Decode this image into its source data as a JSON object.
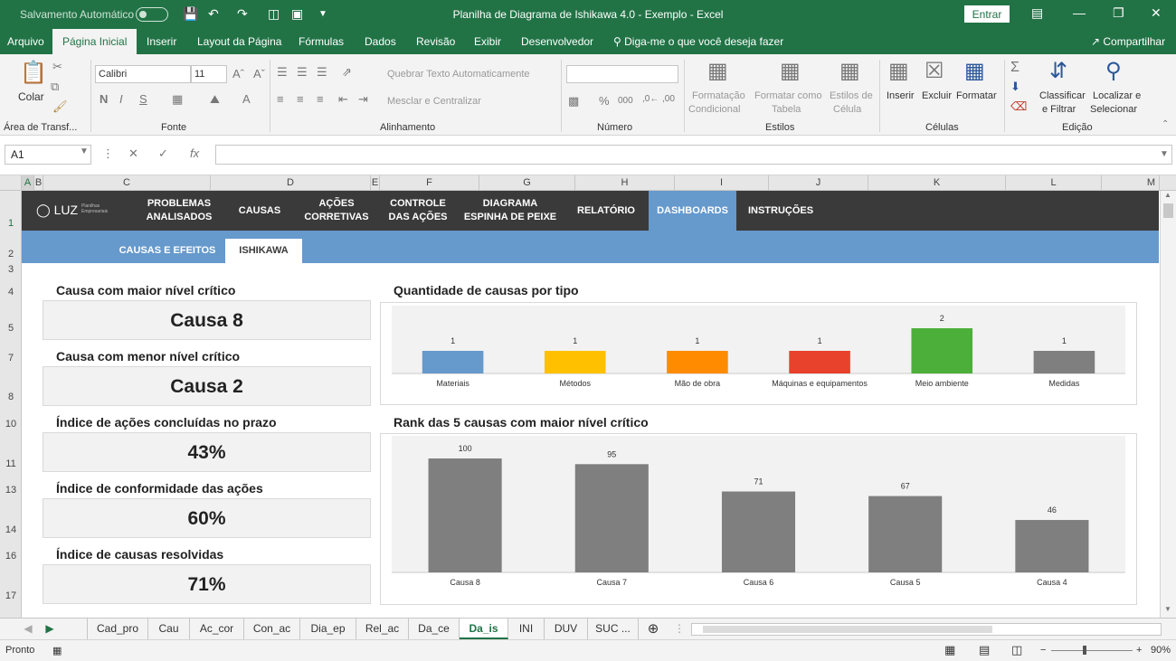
{
  "titlebar": {
    "autosave_label": "Salvamento Automático",
    "title": "Planilha de Diagrama de Ishikawa 4.0 - Exemplo  -  Excel",
    "entrar_label": "Entrar"
  },
  "ribbon_tabs": [
    "Arquivo",
    "Página Inicial",
    "Inserir",
    "Layout da Página",
    "Fórmulas",
    "Dados",
    "Revisão",
    "Exibir",
    "Desenvolvedor"
  ],
  "tell_me": "Diga-me o que você deseja fazer",
  "share_label": "Compartilhar",
  "ribbon": {
    "paste_label": "Colar",
    "clipboard_group": "Área de Transf...",
    "font_name": "Calibri",
    "font_size": "11",
    "font_group": "Fonte",
    "wrap_text": "Quebrar Texto Automaticamente",
    "merge_center": "Mesclar e Centralizar",
    "alignment_group": "Alinhamento",
    "number_group": "Número",
    "cond_format_1": "Formatação",
    "cond_format_2": "Condicional",
    "format_table_1": "Formatar como",
    "format_table_2": "Tabela",
    "cell_styles_1": "Estilos de",
    "cell_styles_2": "Célula",
    "styles_group": "Estilos",
    "insert_label": "Inserir",
    "delete_label": "Excluir",
    "format_label": "Formatar",
    "cells_group": "Células",
    "sort_1": "Classificar",
    "sort_2": "e Filtrar",
    "find_1": "Localizar e",
    "find_2": "Selecionar",
    "editing_group": "Edição"
  },
  "formula_bar": {
    "name_box": "A1",
    "fx": "fx"
  },
  "columns": [
    "A",
    "B",
    "C",
    "D",
    "E",
    "F",
    "G",
    "H",
    "I",
    "J",
    "K",
    "L",
    "M"
  ],
  "rows": [
    "1",
    "2",
    "3",
    "4",
    "5",
    "7",
    "8",
    "10",
    "11",
    "13",
    "14",
    "16",
    "17"
  ],
  "nav": {
    "logo": "LUZ",
    "logo_sub_1": "Planilhas",
    "logo_sub_2": "Empresariais",
    "items": [
      {
        "l1": "PROBLEMAS",
        "l2": "ANALISADOS"
      },
      {
        "l1": "CAUSAS",
        "l2": ""
      },
      {
        "l1": "AÇÕES",
        "l2": "CORRETIVAS"
      },
      {
        "l1": "CONTROLE",
        "l2": "DAS AÇÕES"
      },
      {
        "l1": "DIAGRAMA",
        "l2": "ESPINHA DE PEIXE"
      },
      {
        "l1": "RELATÓRIO",
        "l2": ""
      },
      {
        "l1": "DASHBOARDS",
        "l2": ""
      },
      {
        "l1": "INSTRUÇÕES",
        "l2": ""
      }
    ],
    "subtabs": [
      "CAUSAS E EFEITOS",
      "ISHIKAWA"
    ]
  },
  "kpis": [
    {
      "label": "Causa com maior nível crítico",
      "value": "Causa 8"
    },
    {
      "label": "Causa com menor nível crítico",
      "value": "Causa 2"
    },
    {
      "label": "Índice de ações concluídas no prazo",
      "value": "43%"
    },
    {
      "label": "Índice de conformidade das ações",
      "value": "60%"
    },
    {
      "label": "Índice de causas resolvidas",
      "value": "71%"
    }
  ],
  "chart_data": [
    {
      "type": "bar",
      "title": "Quantidade de causas por tipo",
      "categories": [
        "Materiais",
        "Métodos",
        "Mão de obra",
        "Máquinas e equipamentos",
        "Meio ambiente",
        "Medidas"
      ],
      "values": [
        1,
        1,
        1,
        1,
        2,
        1
      ],
      "colors": [
        "#6699cc",
        "#ffc000",
        "#ff8c00",
        "#e8412c",
        "#4caf3a",
        "#7f7f7f"
      ],
      "ylim": [
        0,
        2
      ],
      "grid": false
    },
    {
      "type": "bar",
      "title": "Rank das 5 causas com maior nível crítico",
      "categories": [
        "Causa 8",
        "Causa 7",
        "Causa 6",
        "Causa 5",
        "Causa 4"
      ],
      "values": [
        100,
        95,
        71,
        67,
        46
      ],
      "colors": [
        "#7f7f7f",
        "#7f7f7f",
        "#7f7f7f",
        "#7f7f7f",
        "#7f7f7f"
      ],
      "ylim": [
        0,
        100
      ],
      "grid": false
    }
  ],
  "sheet_tabs": [
    "Cad_pro",
    "Cau",
    "Ac_cor",
    "Con_ac",
    "Dia_ep",
    "Rel_ac",
    "Da_ce",
    "Da_is",
    "INI",
    "DUV",
    "SUC ..."
  ],
  "status": {
    "ready": "Pronto",
    "zoom": "90%"
  }
}
